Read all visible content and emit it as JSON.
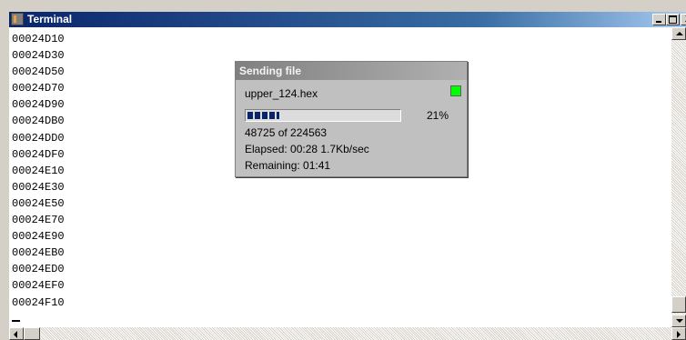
{
  "window": {
    "title": "Terminal",
    "min_glyph": "_",
    "max_glyph": "□",
    "close_glyph": "X"
  },
  "terminal": {
    "lines": [
      "00024D10",
      "00024D30",
      "00024D50",
      "00024D70",
      "00024D90",
      "00024DB0",
      "00024DD0",
      "00024DF0",
      "00024E10",
      "00024E30",
      "00024E50",
      "00024E70",
      "00024E90",
      "00024EB0",
      "00024ED0",
      "00024EF0",
      "00024F10"
    ]
  },
  "dialog": {
    "title": "Sending file",
    "filename": "upper_124.hex",
    "status_color": "#00ff00",
    "progress_percent": 21,
    "progress_label": "21%",
    "bytes_text": "48725 of 224563",
    "elapsed_text": "Elapsed: 00:28  1.7Kb/sec",
    "remaining_text": "Remaining: 01:41"
  },
  "icons": {
    "app": "terminal-app-icon"
  }
}
